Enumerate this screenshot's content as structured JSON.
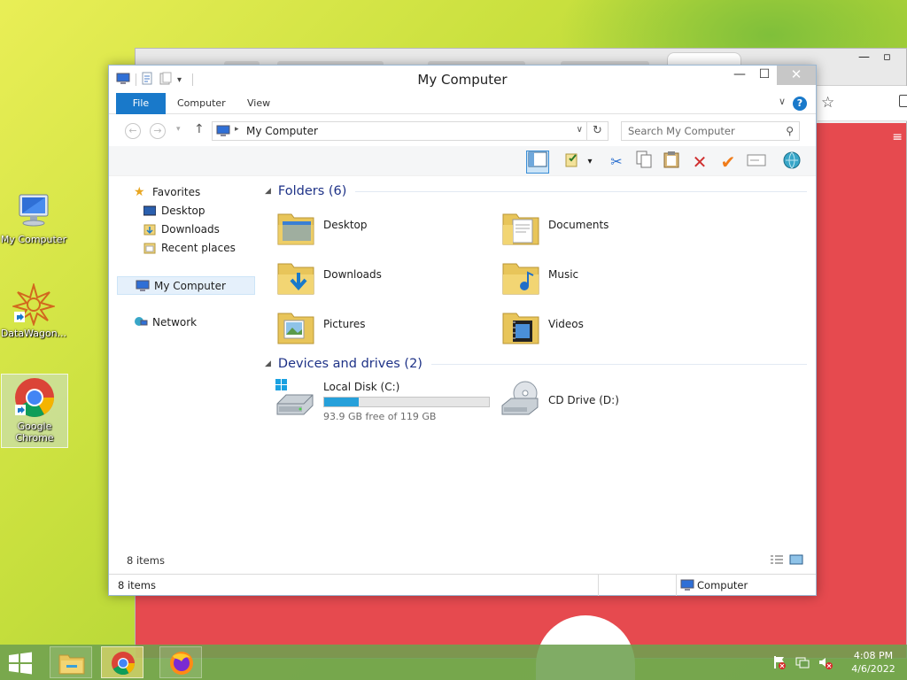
{
  "desktop": {
    "icons": [
      {
        "label": "My Computer"
      },
      {
        "label": "DataWagon..."
      },
      {
        "label": "Google Chrome"
      }
    ]
  },
  "explorer": {
    "title": "My Computer",
    "ribbon_tabs": [
      "File",
      "Computer",
      "View"
    ],
    "address": "My Computer",
    "search_placeholder": "Search My Computer",
    "nav": {
      "favorites": "Favorites",
      "favorites_items": [
        "Desktop",
        "Downloads",
        "Recent places"
      ],
      "my_computer": "My Computer",
      "network": "Network"
    },
    "folders_header": "Folders (6)",
    "folders": [
      "Desktop",
      "Documents",
      "Downloads",
      "Music",
      "Pictures",
      "Videos"
    ],
    "devices_header": "Devices and drives (2)",
    "drives": [
      {
        "name": "Local Disk (C:)",
        "free_text": "93.9 GB free of 119 GB",
        "used_fraction": 0.21
      },
      {
        "name": "CD Drive (D:)"
      }
    ],
    "inner_status": "8 items",
    "status_left": "8 items",
    "status_right": "Computer"
  },
  "taskbar": {
    "time": "4:08 PM",
    "date": "4/6/2022"
  },
  "colors": {
    "accent": "#1979ca",
    "drive_bar": "#26a0da",
    "group_header": "#1e3287",
    "bg_page": "#e64a4f"
  }
}
